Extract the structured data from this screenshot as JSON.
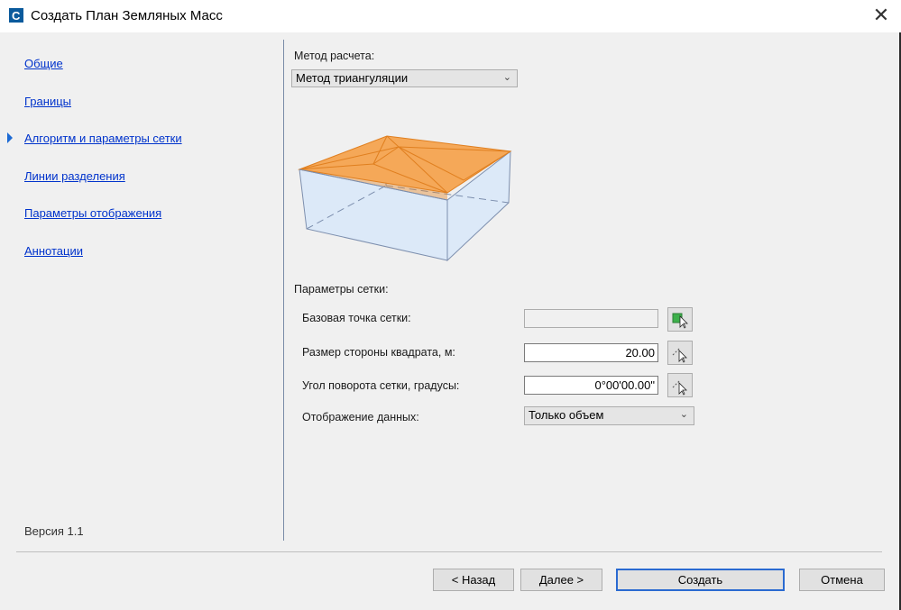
{
  "window": {
    "title": "Создать План Земляных Масс",
    "close_label": "✕"
  },
  "nav": {
    "items": [
      {
        "label": "Общие"
      },
      {
        "label": "Границы"
      },
      {
        "label": "Алгоритм и параметры сетки"
      },
      {
        "label": "Линии разделения"
      },
      {
        "label": "Параметры отображения"
      },
      {
        "label": "Аннотации"
      }
    ],
    "active_index": 2,
    "version": "Версия 1.1"
  },
  "method": {
    "label": "Метод расчета:",
    "value": "Метод триангуляции"
  },
  "grid": {
    "header": "Параметры сетки:",
    "base_point": {
      "label": "Базовая точка сетки:",
      "value": ""
    },
    "square_size": {
      "label": "Размер стороны квадрата, м:",
      "value": "20.00"
    },
    "rotation": {
      "label": "Угол поворота сетки, градусы:",
      "value": "0°00'00.00\""
    },
    "display": {
      "label": "Отображение данных:",
      "value": "Только объем"
    }
  },
  "buttons": {
    "back": "< Назад",
    "next": "Далее >",
    "create": "Создать",
    "cancel": "Отмена"
  },
  "colors": {
    "link": "#0033cc",
    "accent": "#2a6ad1",
    "surface_fill": "#f5a858",
    "box_fill": "#dce9f8"
  }
}
